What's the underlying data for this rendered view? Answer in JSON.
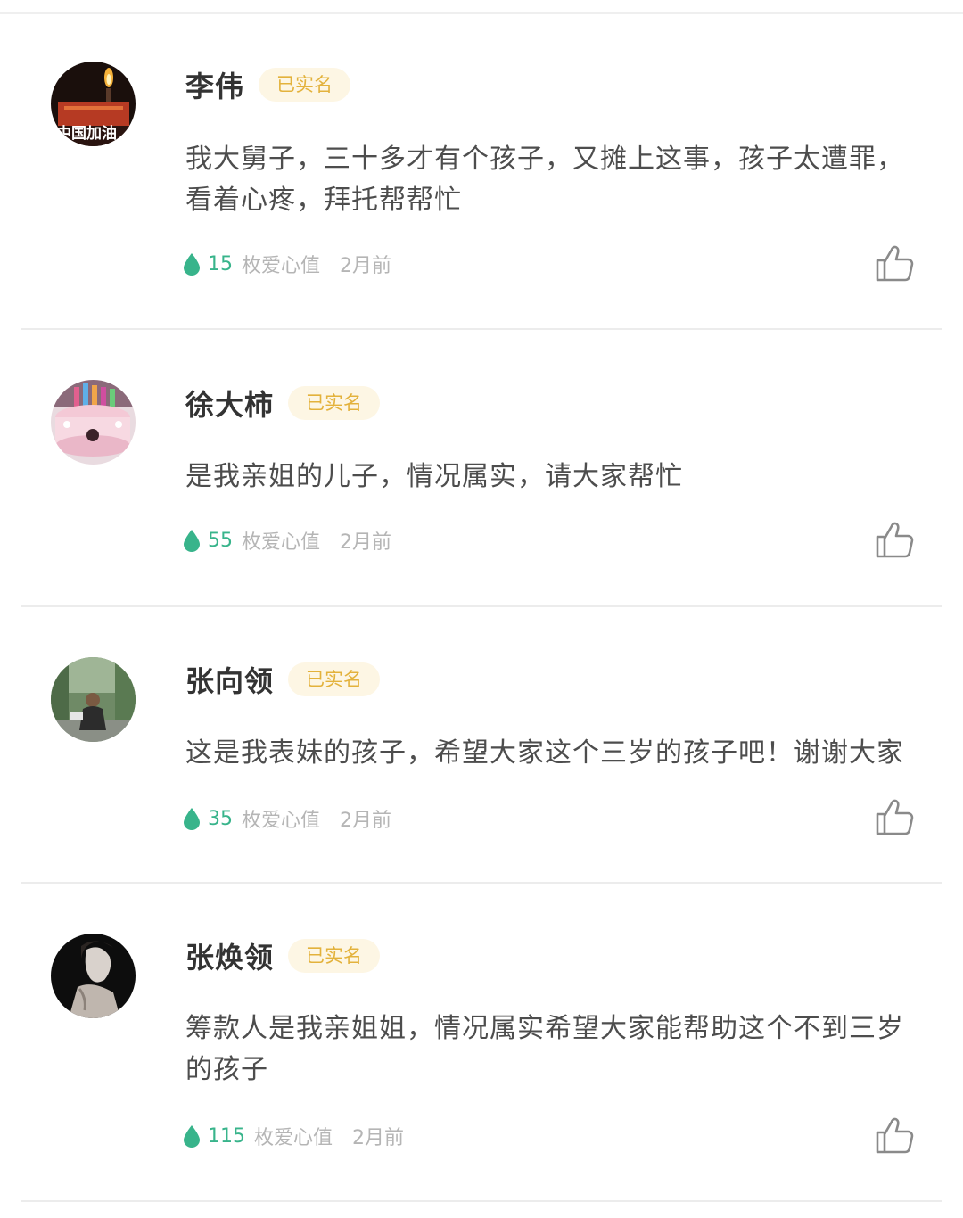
{
  "badge_label": "已实名",
  "love_unit": "枚爱心值",
  "colors": {
    "badge_bg": "#fdf6e4",
    "badge_text": "#e3b23c",
    "love_green": "#38b48b",
    "muted": "#b5b5b5"
  },
  "comments": [
    {
      "name": "李伟",
      "avatar_overlay_text": "中国加油",
      "lines": [
        "我大舅子，三十多才有个孩子，又摊上这事，孩子太遭罪，",
        "看着心疼，拜托帮帮忙"
      ],
      "love": "15",
      "time": "2月前"
    },
    {
      "name": "徐大柿",
      "lines": [
        "是我亲姐的儿子，情况属实，请大家帮忙"
      ],
      "love": "55",
      "time": "2月前"
    },
    {
      "name": "张向领",
      "lines": [
        "这是我表妹的孩子，希望大家这个三岁的孩子吧！谢谢大家"
      ],
      "love": "35",
      "time": "2月前"
    },
    {
      "name": "张焕领",
      "lines": [
        "筹款人是我亲姐姐，情况属实希望大家能帮助这个不到三岁",
        "的孩子"
      ],
      "love": "115",
      "time": "2月前"
    }
  ]
}
